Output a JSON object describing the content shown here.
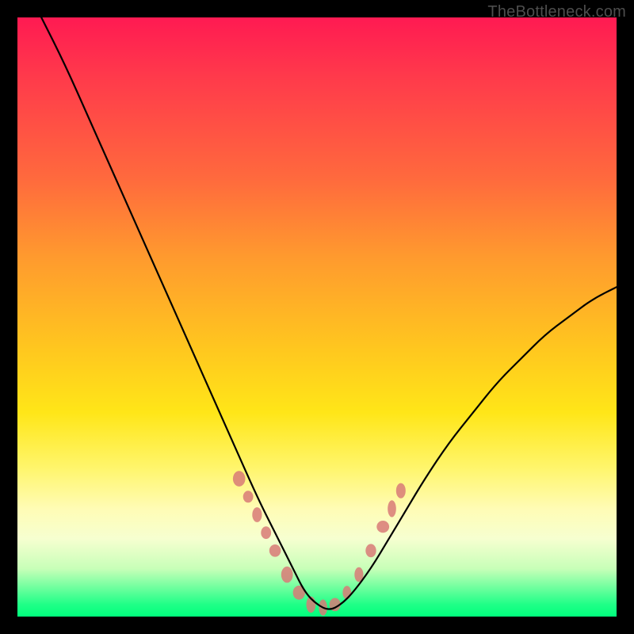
{
  "watermark": "TheBottleneck.com",
  "chart_data": {
    "type": "line",
    "title": "",
    "xlabel": "",
    "ylabel": "",
    "xlim": [
      0,
      100
    ],
    "ylim": [
      0,
      100
    ],
    "series": [
      {
        "name": "bottleneck-curve",
        "color": "#000000",
        "x": [
          4,
          8,
          12,
          16,
          20,
          24,
          28,
          32,
          36,
          40,
          43,
          46,
          48,
          50,
          52,
          54,
          56,
          59,
          62,
          65,
          68,
          72,
          76,
          80,
          84,
          88,
          92,
          96,
          100
        ],
        "y": [
          100,
          92,
          83,
          74,
          65,
          56,
          47,
          38,
          29,
          20,
          14,
          8,
          4,
          2,
          1,
          2,
          4,
          8,
          13,
          18,
          23,
          29,
          34,
          39,
          43,
          47,
          50,
          53,
          55
        ]
      },
      {
        "name": "marker-cluster",
        "type": "scatter",
        "color": "#d87a77",
        "x": [
          37,
          38.5,
          40,
          41.5,
          43,
          45,
          47,
          49,
          51,
          53,
          55,
          57,
          59,
          61,
          62.5,
          64
        ],
        "y": [
          23,
          20,
          17,
          14,
          11,
          7,
          4,
          2,
          1.5,
          2,
          4,
          7,
          11,
          15,
          18,
          21
        ]
      }
    ],
    "gradient_stops": [
      {
        "offset": 0,
        "color": "#ff1a52"
      },
      {
        "offset": 10,
        "color": "#ff3a4b"
      },
      {
        "offset": 27,
        "color": "#ff6a3d"
      },
      {
        "offset": 40,
        "color": "#ff9a2e"
      },
      {
        "offset": 55,
        "color": "#ffc61f"
      },
      {
        "offset": 66,
        "color": "#ffe618"
      },
      {
        "offset": 75,
        "color": "#fff56a"
      },
      {
        "offset": 82,
        "color": "#fffcb5"
      },
      {
        "offset": 87,
        "color": "#f6ffd0"
      },
      {
        "offset": 92,
        "color": "#c8ffb8"
      },
      {
        "offset": 98,
        "color": "#1fff87"
      },
      {
        "offset": 100,
        "color": "#00ff7d"
      }
    ]
  }
}
